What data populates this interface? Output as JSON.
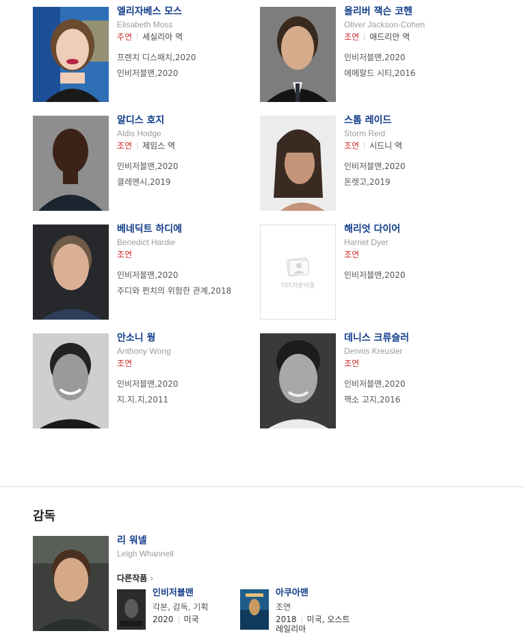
{
  "cast": [
    {
      "name": "엘리자베스 모스",
      "english_name": "Elisabeth Moss",
      "role": "주연",
      "character": "세실리아 역",
      "works": [
        "프렌치 디스패치,2020",
        "인비저블맨,2020"
      ]
    },
    {
      "name": "올리버 잭슨 코헨",
      "english_name": "Oliver Jackson-Cohen",
      "role": "조연",
      "character": "애드리안 역",
      "works": [
        "인비저블맨,2020",
        "에메랄드 시티,2016"
      ]
    },
    {
      "name": "알디스 호지",
      "english_name": "Aldis Hodge",
      "role": "조연",
      "character": "제임스 역",
      "works": [
        "인비저블맨,2020",
        "클레멘시,2019"
      ]
    },
    {
      "name": "스톰 레이드",
      "english_name": "Storm Reid",
      "role": "조연",
      "character": "시드니 역",
      "works": [
        "인비저블맨,2020",
        "돈렛고,2019"
      ]
    },
    {
      "name": "베네딕트 하디에",
      "english_name": "Benedict Hardie",
      "role": "조연",
      "character": "",
      "works": [
        "인비저블맨,2020",
        "주디와 펀치의 위험한 관계,2018"
      ]
    },
    {
      "name": "해리엇 다이어",
      "english_name": "Harriet Dyer",
      "role": "조연",
      "character": "",
      "works": [
        "인비저블맨,2020"
      ],
      "placeholder_text": "이미지준비중"
    },
    {
      "name": "안소니 웡",
      "english_name": "Anthony Wong",
      "role": "조연",
      "character": "",
      "works": [
        "인비저블맨,2020",
        "지.지.지,2011"
      ]
    },
    {
      "name": "데니스 크류슬러",
      "english_name": "Dennis Kreusler",
      "role": "조연",
      "character": "",
      "works": [
        "인비저블맨,2020",
        "핵소 고지,2016"
      ]
    }
  ],
  "director_section": {
    "title": "감독",
    "name": "리 워넬",
    "english_name": "Leigh Whannell",
    "more_label": "다른작품",
    "films": [
      {
        "title": "인비저블맨",
        "credits": "각본, 감독, 기획",
        "year": "2020",
        "country": "미국"
      },
      {
        "title": "아쿠아맨",
        "credits": "조연",
        "year": "2018",
        "country": "미국, 오스트레일리아"
      }
    ]
  }
}
